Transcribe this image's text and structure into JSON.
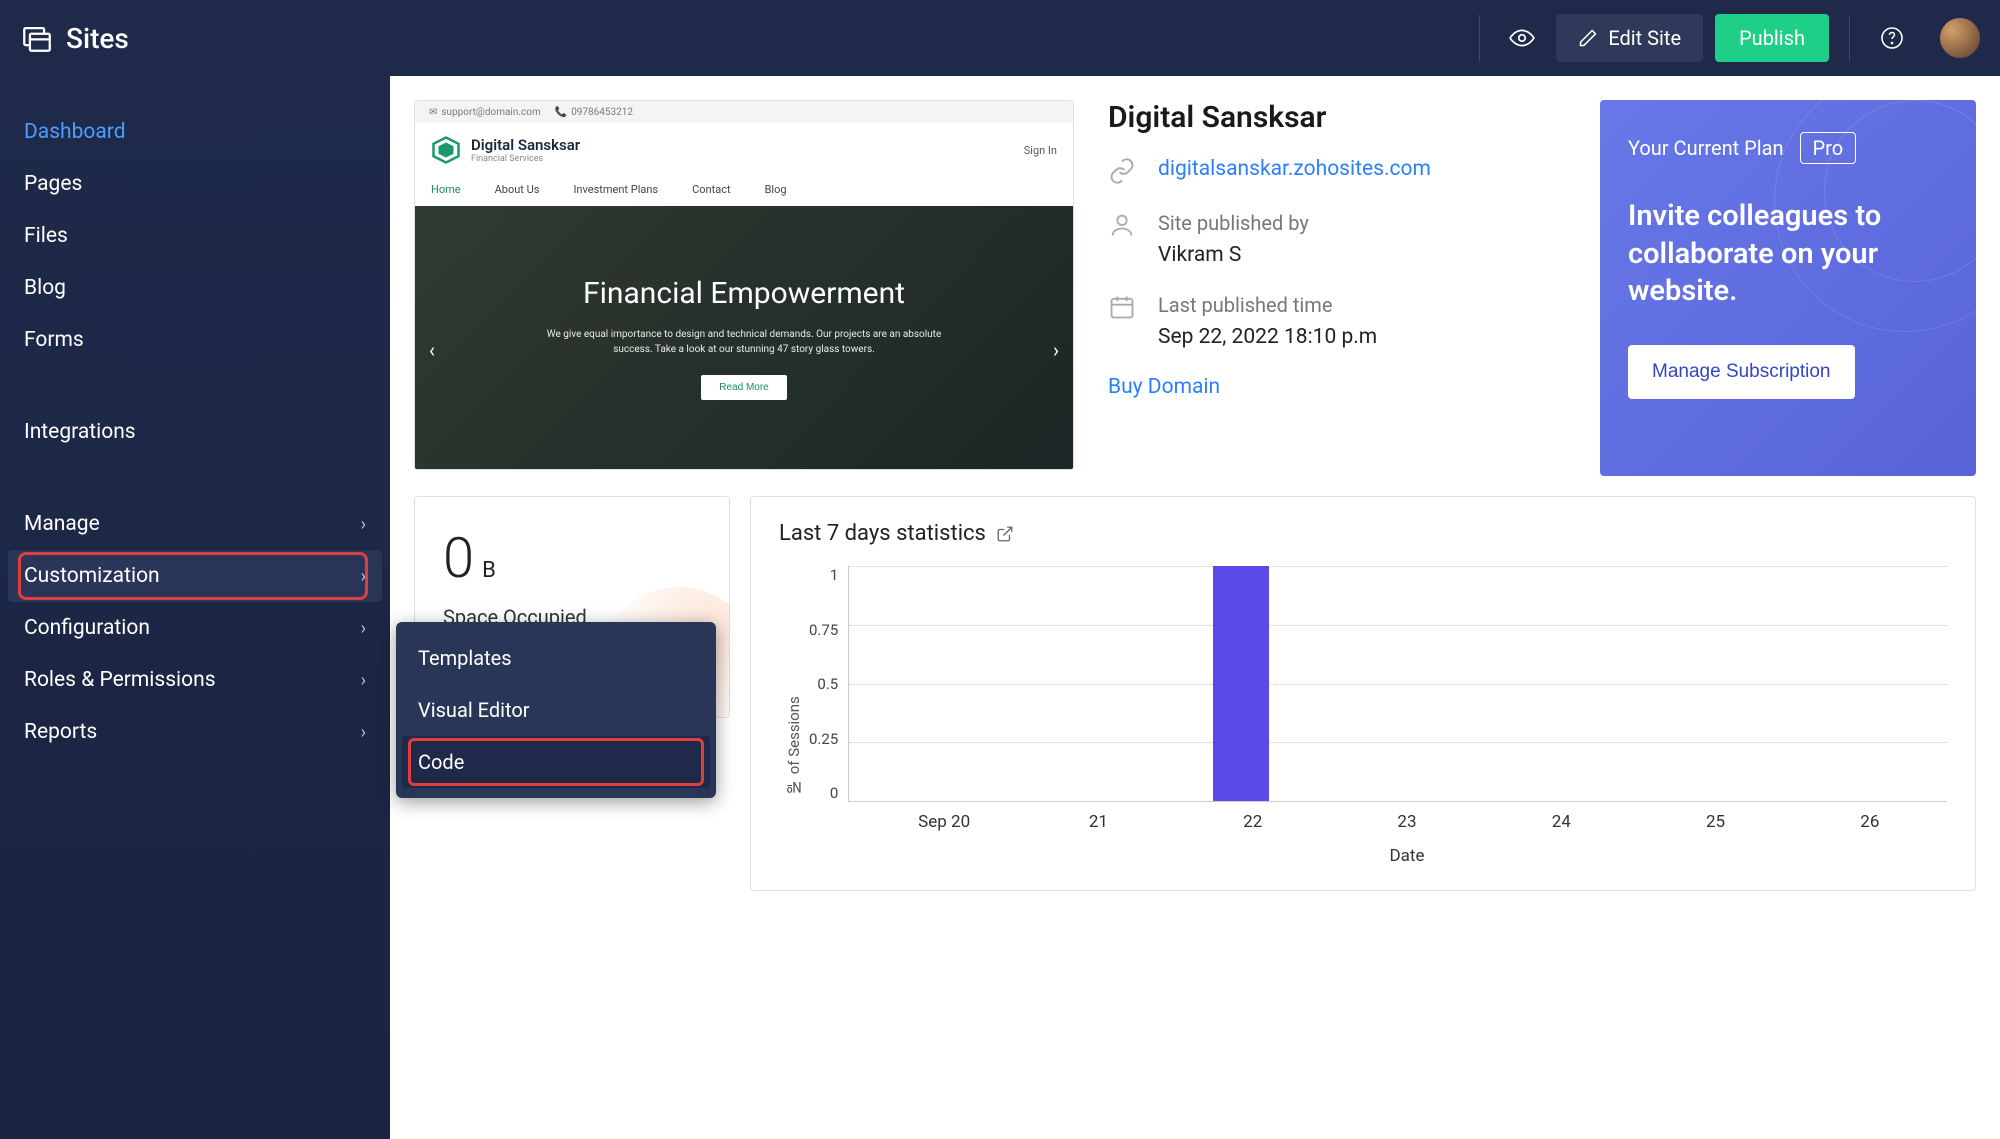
{
  "topbar": {
    "title": "Sites",
    "edit_label": "Edit Site",
    "publish_label": "Publish"
  },
  "sidebar": {
    "items": [
      {
        "label": "Dashboard",
        "active": true
      },
      {
        "label": "Pages"
      },
      {
        "label": "Files"
      },
      {
        "label": "Blog"
      },
      {
        "label": "Forms"
      }
    ],
    "integrations": "Integrations",
    "expandable": [
      {
        "label": "Manage"
      },
      {
        "label": "Customization",
        "highlight": true,
        "hovered": true
      },
      {
        "label": "Configuration"
      },
      {
        "label": "Roles & Permissions"
      },
      {
        "label": "Reports"
      }
    ]
  },
  "submenu": {
    "items": [
      {
        "label": "Templates"
      },
      {
        "label": "Visual Editor"
      },
      {
        "label": "Code",
        "highlight": true
      }
    ]
  },
  "preview": {
    "email": "support@domain.com",
    "phone": "09786453212",
    "brand": "Digital Sansksar",
    "brand_sub": "Financial Services",
    "signin": "Sign In",
    "nav": [
      "Home",
      "About Us",
      "Investment Plans",
      "Contact",
      "Blog"
    ],
    "hero_title": "Financial Empowerment",
    "hero_text": "We give equal importance to design and technical demands. Our projects are an absolute success. Take a look at our stunning 47 story glass towers.",
    "hero_btn": "Read More"
  },
  "siteinfo": {
    "title": "Digital Sansksar",
    "url": "digitalsanskar.zohosites.com",
    "published_by_label": "Site published by",
    "published_by": "Vikram S",
    "last_pub_label": "Last published time",
    "last_pub": "Sep 22, 2022 18:10 p.m",
    "buy_domain": "Buy Domain"
  },
  "plan": {
    "current_label": "Your Current Plan",
    "badge": "Pro",
    "headline": "Invite colleagues to collaborate on your website.",
    "button": "Manage Subscription"
  },
  "space": {
    "value": "0",
    "unit": "B",
    "label": "Space Occupied"
  },
  "stats": {
    "title": "Last 7 days statistics"
  },
  "chart_data": {
    "type": "bar",
    "categories": [
      "Sep 20",
      "21",
      "22",
      "23",
      "24",
      "25",
      "26"
    ],
    "values": [
      0,
      0,
      1,
      0,
      0,
      0,
      0
    ],
    "xlabel": "Date",
    "ylabel": "№ of Sessions",
    "ylim": [
      0,
      1
    ],
    "y_ticks": [
      "1",
      "0.75",
      "0.5",
      "0.25",
      "0"
    ]
  }
}
